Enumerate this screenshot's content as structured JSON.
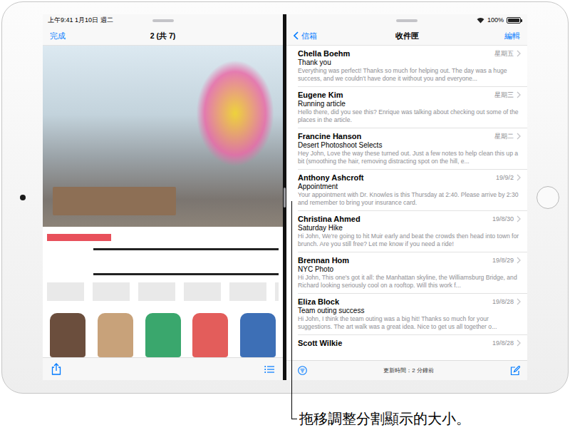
{
  "caption": "拖移調整分割顯示的大小。",
  "left_pane": {
    "status_bar": {
      "time": "上午9:41 1月10日 週二"
    },
    "nav": {
      "done": "完成",
      "title": "2 (共 7)"
    }
  },
  "right_pane": {
    "status_bar": {
      "battery": {
        "reading": "100%",
        "level": 1
      }
    },
    "nav": {
      "back": "信箱",
      "title": "收件匣",
      "edit": "編輯"
    },
    "messages": [
      {
        "sender": "Chella Boehm",
        "date": "星期五",
        "subject": "Thank you",
        "preview": "Everything was perfect! Thanks so much for helping out. The day was a huge success, and we couldn't have done it without you and everyone..."
      },
      {
        "sender": "Eugene Kim",
        "date": "星期三",
        "subject": "Running article",
        "preview": "Hello there, did you see this? Enrique was talking about checking out some of the places in the article."
      },
      {
        "sender": "Francine Hanson",
        "date": "星期二",
        "subject": "Desert Photoshoot Selects",
        "preview": "Hey John, Love the way these turned out. Just a few notes to help clean this up a bit (smoothing the hair, removing distracting spot on the hill, e..."
      },
      {
        "sender": "Anthony Ashcroft",
        "date": "19/9/2",
        "subject": "Appointment",
        "preview": "Your appointment with Dr. Knowles is this Thursday at 2:40. Please arrive by 2:30 and remember to bring your insurance card."
      },
      {
        "sender": "Christina Ahmed",
        "date": "19/8/30",
        "subject": "Saturday Hike",
        "preview": "Hi John, We're going to hit Muir early and beat the crowds then head into town for brunch. Are you still free? Let me know if you need a ride!"
      },
      {
        "sender": "Brennan Hom",
        "date": "19/8/29",
        "subject": "NYC Photo",
        "preview": "Hi John, This one's got it all: the Manhattan skyline, the Williamsburg Bridge, and Richard looking seriously cool on a rooftop. Will this work f..."
      },
      {
        "sender": "Eliza Block",
        "date": "19/8/28",
        "subject": "Team outing success",
        "preview": "Hi John, I think the team outing was a big hit! Thanks so much for your suggestions. The art walk was a great idea. Nice to get us all together o..."
      },
      {
        "sender": "Scott Wilkie",
        "date": "19/8/28"
      }
    ],
    "toolbar": {
      "status": "更新時間：2 分鐘前"
    }
  }
}
